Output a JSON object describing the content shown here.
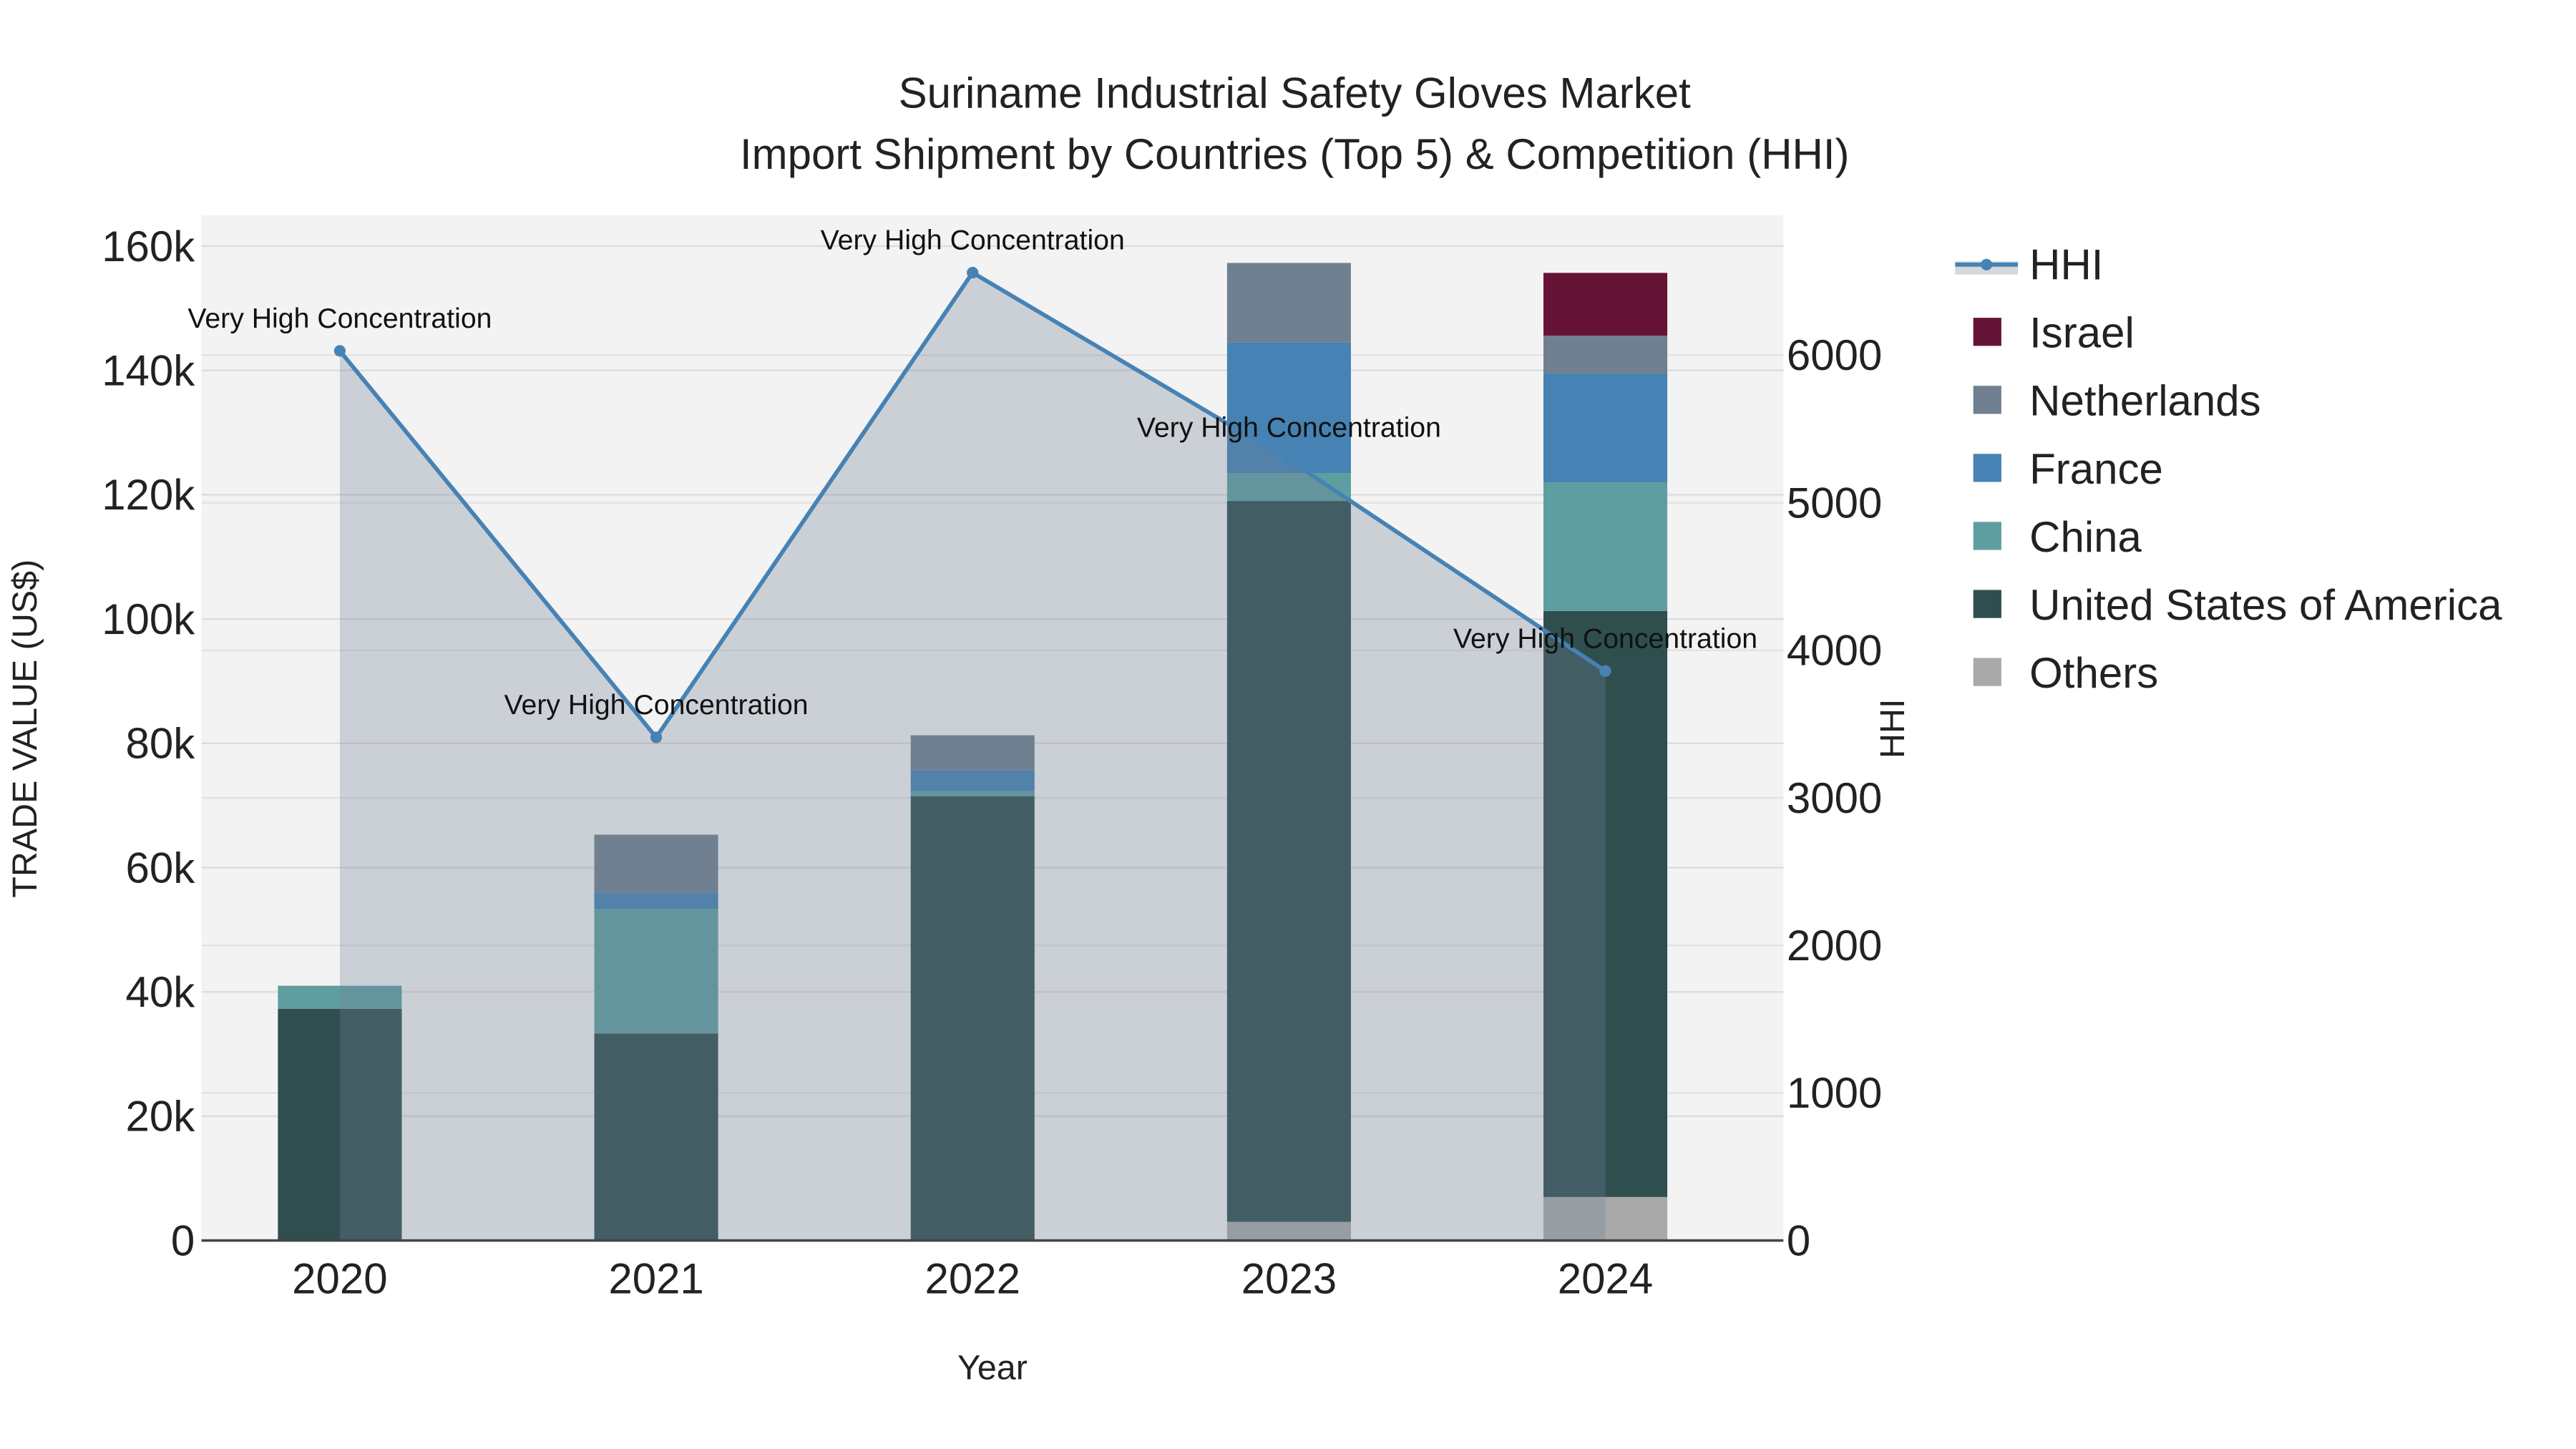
{
  "chart_data": {
    "type": "bar",
    "title_line1": "Suriname Industrial Safety Gloves Market",
    "title_line2": "Import Shipment by Countries (Top 5) & Competition (HHI)",
    "xlabel": "Year",
    "ylabel": "TRADE VALUE (US$)",
    "y2label": "HHI",
    "categories": [
      "2020",
      "2021",
      "2022",
      "2023",
      "2024"
    ],
    "ylim": [
      0,
      165000
    ],
    "y2lim": [
      0,
      6950
    ],
    "yticks": [
      0,
      20000,
      40000,
      60000,
      80000,
      100000,
      120000,
      140000,
      160000
    ],
    "ytick_labels": [
      "0",
      "20k",
      "40k",
      "60k",
      "80k",
      "100k",
      "120k",
      "140k",
      "160k"
    ],
    "y2ticks": [
      0,
      1000,
      2000,
      3000,
      4000,
      5000,
      6000
    ],
    "y2tick_labels": [
      "0",
      "1000",
      "2000",
      "3000",
      "4000",
      "5000",
      "6000"
    ],
    "series": [
      {
        "name": "Others",
        "color": "#a9a9a9",
        "values": [
          0,
          0,
          0,
          3000,
          7000
        ]
      },
      {
        "name": "United States of America",
        "color": "#2f4f4f",
        "values": [
          37300,
          33300,
          71500,
          116000,
          94300
        ]
      },
      {
        "name": "China",
        "color": "#5f9ea0",
        "values": [
          3700,
          20000,
          800,
          4500,
          20700
        ]
      },
      {
        "name": "France",
        "color": "#4682b4",
        "values": [
          0,
          2700,
          3400,
          21000,
          17500
        ]
      },
      {
        "name": "Netherlands",
        "color": "#708090",
        "values": [
          0,
          9300,
          5600,
          12800,
          6100
        ]
      },
      {
        "name": "Israel",
        "color": "#651435",
        "values": [
          0,
          0,
          0,
          0,
          10100
        ]
      }
    ],
    "hhi": {
      "name": "HHI",
      "color": "#4682b4",
      "values": [
        6030,
        3410,
        6560,
        5290,
        3860
      ],
      "annotations": [
        "Very High Concentration",
        "Very High Concentration",
        "Very High Concentration",
        "Very High Concentration",
        "Very High Concentration"
      ]
    },
    "legend_order": [
      "HHI",
      "Israel",
      "Netherlands",
      "France",
      "China",
      "United States of America",
      "Others"
    ],
    "legend_placement": "right",
    "grid": true
  }
}
